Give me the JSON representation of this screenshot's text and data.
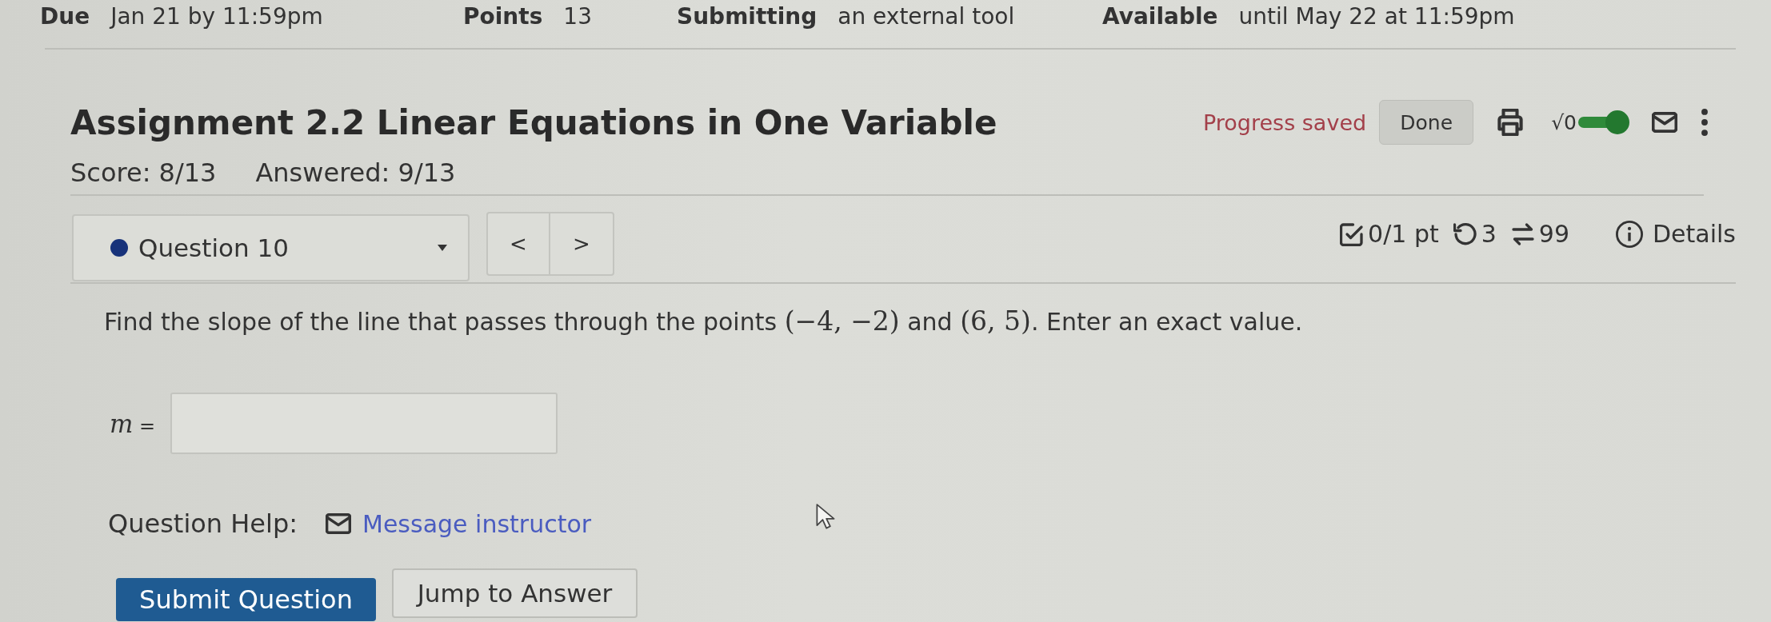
{
  "assignment_info": [
    {
      "label": "Due",
      "value": "Jan 21 by 11:59pm"
    },
    {
      "label": "Points",
      "value": "13"
    },
    {
      "label": "Submitting",
      "value": "an external tool"
    },
    {
      "label": "Available",
      "value": "until May 22 at 11:59pm"
    }
  ],
  "header": {
    "title": "Assignment 2.2 Linear Equations in One Variable",
    "status": "Progress saved",
    "done_button": "Done",
    "math_toggle": {
      "symbol": "√0",
      "on": true
    }
  },
  "score": {
    "score": "Score: 8/13",
    "answered": "Answered: 9/13"
  },
  "question_nav": {
    "current": "Question 10",
    "previous": "<",
    "next": ">"
  },
  "question_meta": [
    {
      "kind": "points",
      "text": "0/1 pt"
    },
    {
      "kind": "retries",
      "text": "3"
    },
    {
      "kind": "versions",
      "text": "99"
    },
    {
      "kind": "details",
      "text": "Details"
    }
  ],
  "question": {
    "parts": [
      {
        "kind": "text",
        "text": "Find the slope of the line that passes through the points "
      },
      {
        "kind": "math",
        "text": "(−4, −2)"
      },
      {
        "kind": "text",
        "text": " and "
      },
      {
        "kind": "math",
        "text": "(6, 5)"
      },
      {
        "kind": "text",
        "text": ". Enter an exact value."
      }
    ]
  },
  "answer": {
    "variable": "m",
    "sign": "="
  },
  "help": {
    "label": "Question Help:",
    "link": "Message instructor"
  },
  "buttons": [
    {
      "kind": "primary",
      "label": "Submit Question"
    },
    {
      "kind": "secondary",
      "label": "Jump to Answer"
    }
  ]
}
